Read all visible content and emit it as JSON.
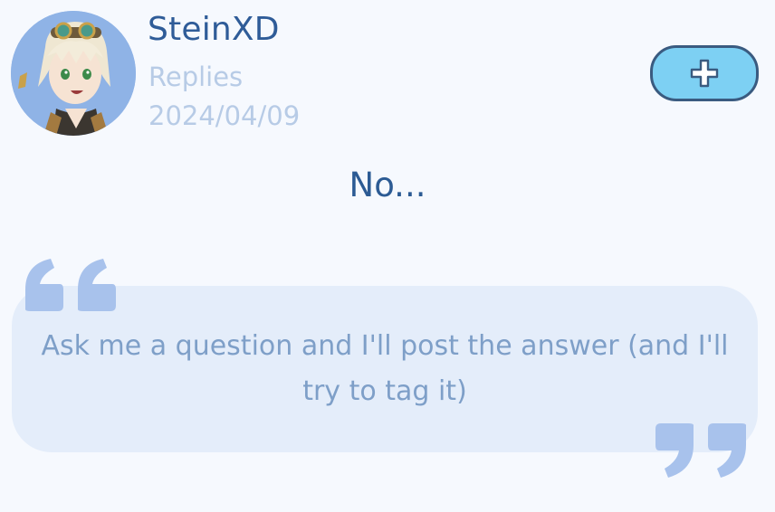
{
  "profile": {
    "username": "SteinXD",
    "category": "Replies",
    "date": "2024/04/09",
    "avatar_icon": "anime-avatar-icon"
  },
  "actions": {
    "follow_icon": "plus-icon",
    "follow_color": "#7dd0f3"
  },
  "post": {
    "answer": "No...",
    "question": "Ask me a question and I'll post the answer (and I'll try to tag it)"
  },
  "colors": {
    "background": "#f6f9fe",
    "primary_text": "#2f5c98",
    "muted_text": "#b7cbe6",
    "quote_box": "#e4edfa",
    "quote_marks": "#a8c2ec"
  }
}
